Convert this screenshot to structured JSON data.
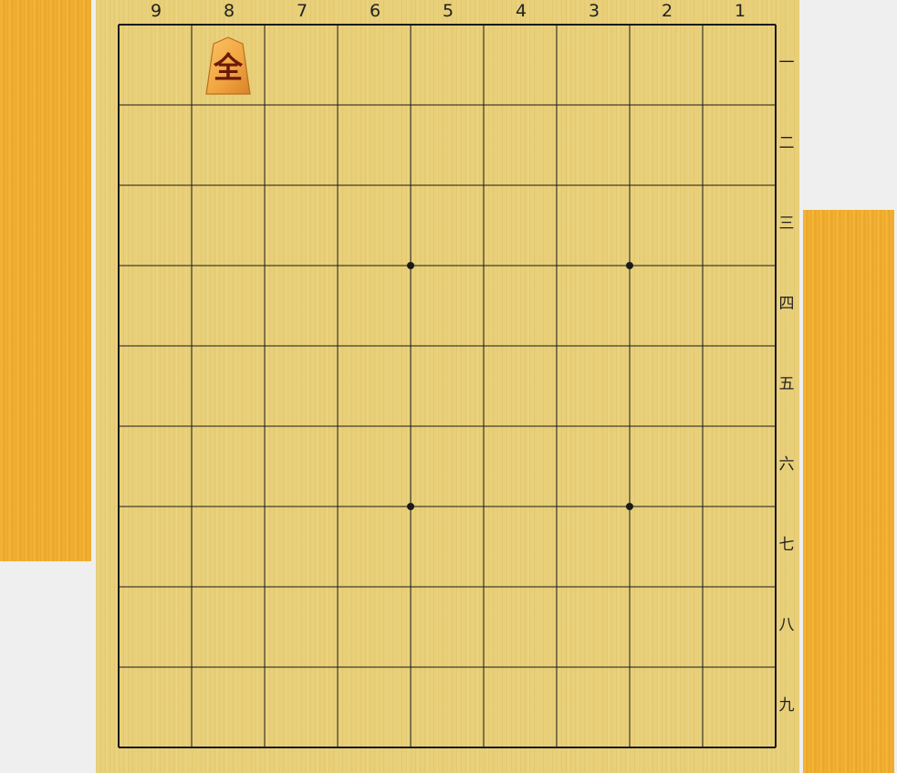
{
  "board": {
    "files": [
      "9",
      "8",
      "7",
      "6",
      "5",
      "4",
      "3",
      "2",
      "1"
    ],
    "ranks": [
      "一",
      "二",
      "三",
      "四",
      "五",
      "六",
      "七",
      "八",
      "九"
    ],
    "hoshi": [
      {
        "file": "6",
        "rank": "三"
      },
      {
        "file": "3",
        "rank": "三"
      },
      {
        "file": "6",
        "rank": "六"
      },
      {
        "file": "3",
        "rank": "六"
      }
    ],
    "pieces": [
      {
        "char": "全",
        "file": "8",
        "rank": "一",
        "owner": "sente"
      }
    ]
  },
  "colors": {
    "board": "#e8cf78",
    "grid_line": "#1a1a1a",
    "komadai": "#f0ad30",
    "piece_face": "#f2a640",
    "piece_text": "#6a1a0a"
  }
}
